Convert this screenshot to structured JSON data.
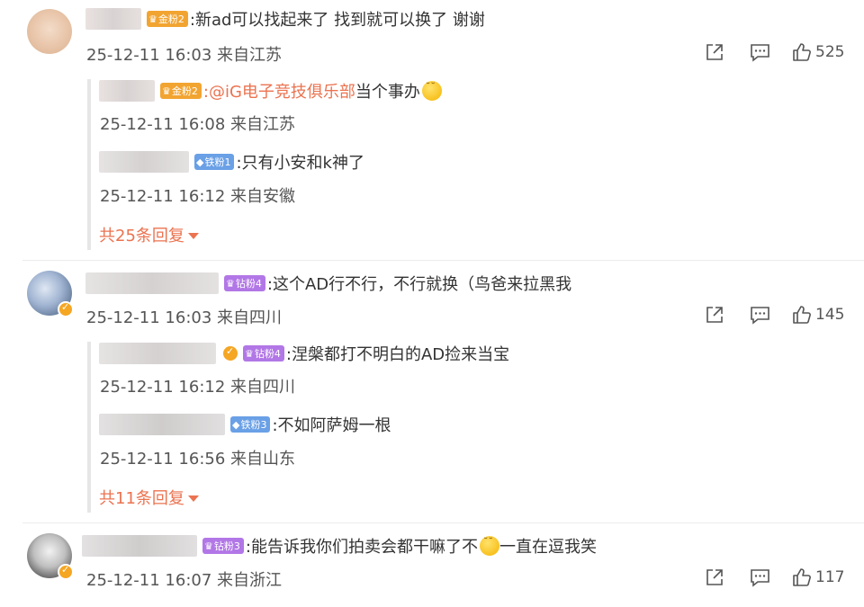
{
  "comments": [
    {
      "text": ":新ad可以找起来了 找到就可以换了 谢谢",
      "fan_badge": "金粉2",
      "meta": "25-12-11 16:03 来自江苏",
      "likes": "525",
      "replies": [
        {
          "fan_badge": "金粉2",
          "mention": ":@iG电子竞技俱乐部",
          "text": " 当个事办",
          "meta": "25-12-11 16:08 来自江苏"
        },
        {
          "fan_badge": "铁粉1",
          "text": ":只有小安和k神了",
          "meta": "25-12-11 16:12 来自安徽"
        }
      ],
      "more_label": "共25条回复"
    },
    {
      "text": ":这个AD行不行，不行就换（鸟爸来拉黑我",
      "fan_badge": "钻粉4",
      "meta": "25-12-11 16:03 来自四川",
      "likes": "145",
      "replies": [
        {
          "fan_badge": "钻粉4",
          "text": ":涅槃都打不明白的AD捡来当宝",
          "meta": "25-12-11 16:12 来自四川"
        },
        {
          "fan_badge": "铁粉3",
          "text": ":不如阿萨姆一根",
          "meta": "25-12-11 16:56 来自山东"
        }
      ],
      "more_label": "共11条回复"
    },
    {
      "text_a": ":能告诉我你们拍卖会都干嘛了不",
      "text_b": "一直在逗我笑",
      "fan_badge": "钻粉3",
      "meta": "25-12-11 16:07 来自浙江",
      "likes": "117"
    }
  ],
  "icons": [
    "share-icon",
    "comment-icon",
    "like-icon",
    "verified-icon",
    "crown-icon",
    "emoji-icon",
    "caret-down-icon"
  ],
  "colors": {
    "accent_orange": "#eb7350",
    "gold_badge": "#f2a431",
    "iron_badge": "#6aa0e6",
    "drill_badge": "#b277e6"
  }
}
